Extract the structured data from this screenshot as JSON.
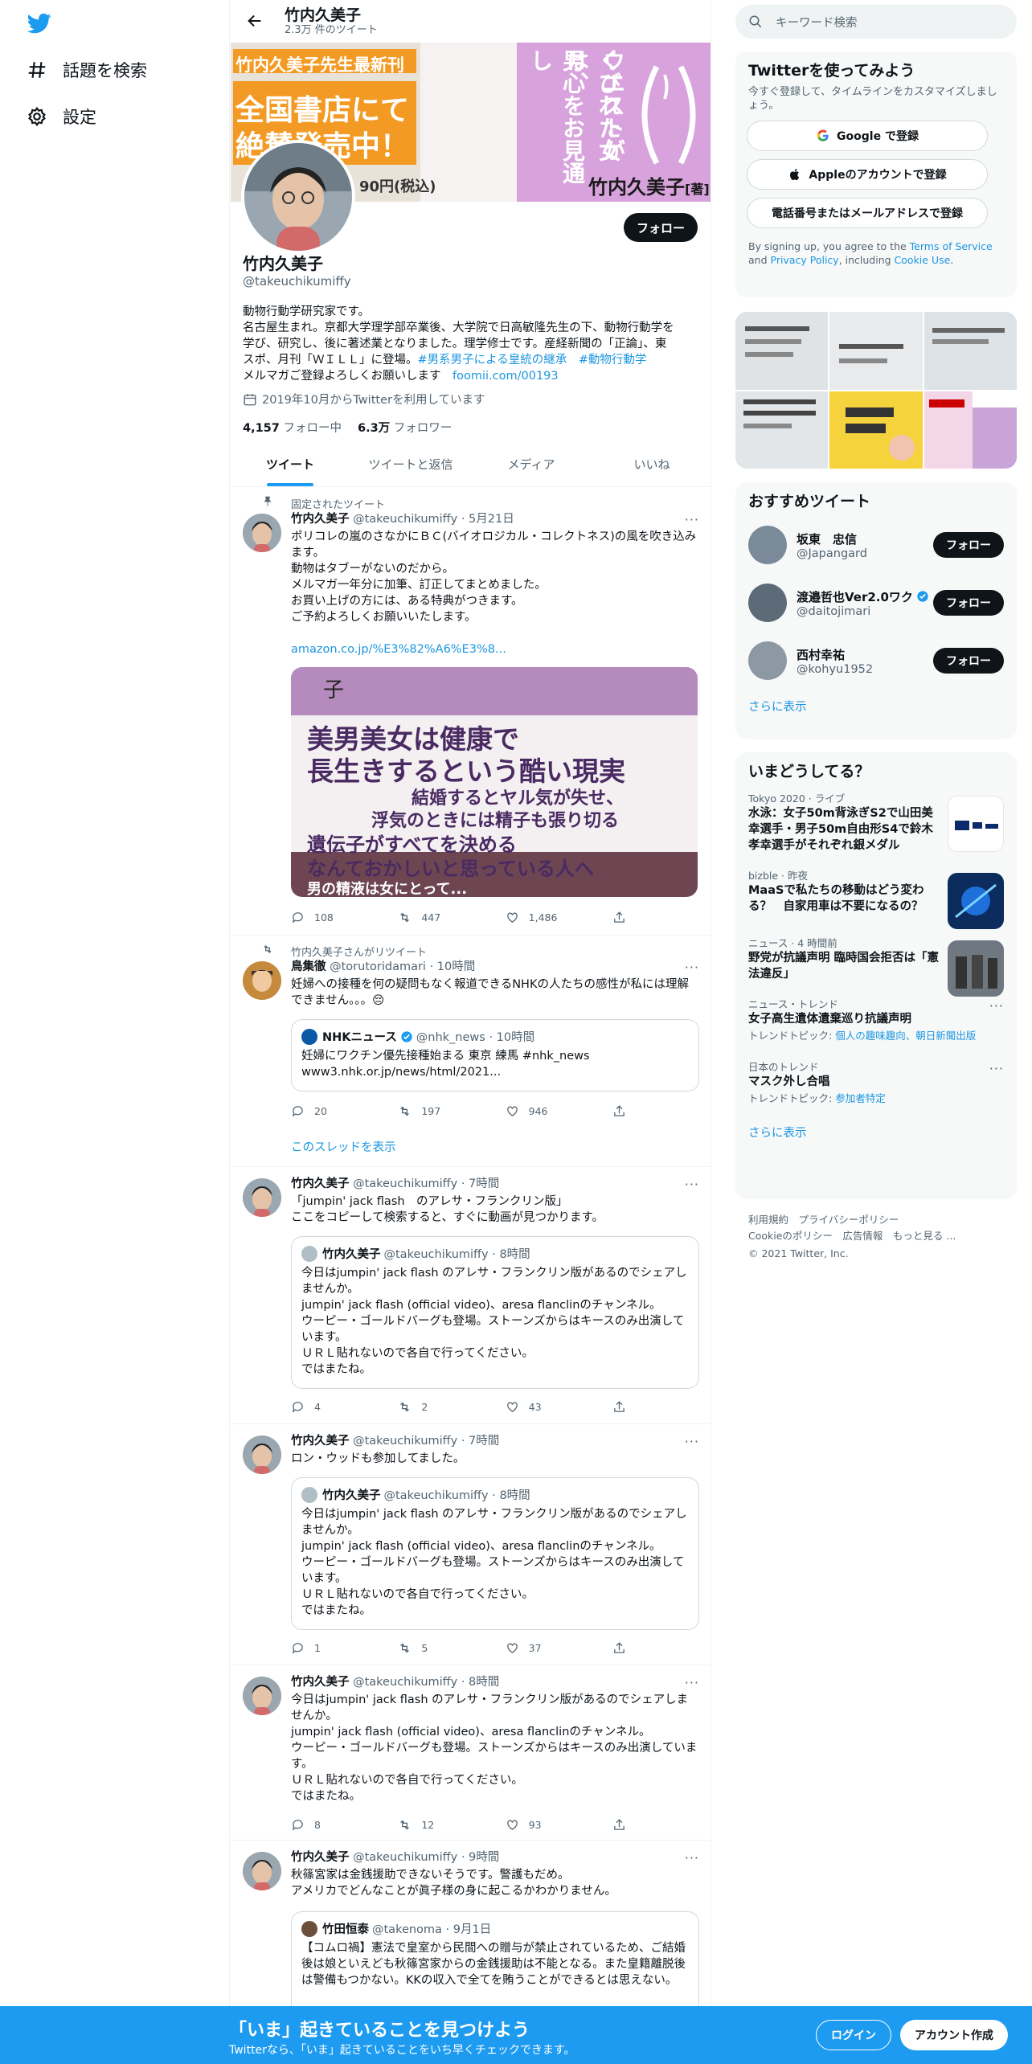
{
  "nav": {
    "explore": "話題を検索",
    "settings": "設定"
  },
  "profile": {
    "top_name": "竹内久美子",
    "tweet_count": "2.3万 件のツイート",
    "name": "竹内久美子",
    "handle": "@takeuchikumiffy",
    "follow": "フォロー",
    "bio_lines": [
      "動物行動学研究家です。",
      "名古屋生まれ。京都大学理学部卒業後、大学院で日高敏隆先生の下、動物行動学を",
      "学び、研究し、後に著述業となりました。理学修士です。産経新聞の「正論」、東"
    ],
    "bio_line4_text": "スポ、月刊「ＷＩＬＬ」に登場。",
    "bio_tag1": "#男系男子による皇統の継承",
    "bio_tag2": "#動物行動学",
    "bio_line5_text": "メルマガご登録よろしくお願いします",
    "bio_link": "foomii.com/00193",
    "joined": "2019年10月からTwitterを利用しています",
    "following_count": "4,157",
    "following_label": "フォロー中",
    "followers_count": "6.3万",
    "followers_label": "フォロワー"
  },
  "banner": {
    "left_top": "竹内久美子先生最新刊",
    "left_mid": "全国書店にて",
    "left_bot": "絶賛発売中！",
    "price": "90円(税込)",
    "book_title_a": "ウエストが",
    "book_title_b": "くびれた女は、",
    "book_title_c": "男心をお見通し",
    "author": "竹内久美子",
    "author_suffix": "[著]"
  },
  "tabs": [
    "ツイート",
    "ツイートと返信",
    "メディア",
    "いいね"
  ],
  "tweets": [
    {
      "context": "固定されたツイート",
      "name": "竹内久美子",
      "handle": "@takeuchikumiffy · 5月21日",
      "text": "ポリコレの嵐のさなかにＢＣ(バイオロジカル・コレクトネス)の風を吹き込みます。\n動物はタブーがないのだから。\nメルマガ一年分に加筆、訂正してまとめました。\nお買い上げの方には、ある特典がつきます。\nご予約よろしくお願いいたします。",
      "link": "amazon.co.jp/%E3%82%A6%E3%8...",
      "image_lines": [
        "美男美女は健康で",
        "長生きするという酷い現実",
        "結婚するとヤル気が失せ、",
        "浮気のときには精子も張り切る",
        "遺伝子がすべてを決める",
        "なんておかしいと思っている人へ",
        "男の精液は女にとって..."
      ],
      "image_top": "子",
      "replies": "108",
      "retweets": "447",
      "likes": "1,486"
    },
    {
      "context": "竹内久美子さんがリツイート",
      "name": "鳥集徹",
      "handle": "@torutoridamari · 10時間",
      "text": "妊婦への接種を何の疑問もなく報道できるNHKの人たちの感性が私には理解できません。。。😔",
      "quote_name": "NHKニュース",
      "quote_handle": "@nhk_news · 10時間",
      "quote_text": "妊婦にワクチン優先接種始まる 東京 練馬 #nhk_news\nwww3.nhk.or.jp/news/html/2021...",
      "replies": "20",
      "retweets": "197",
      "likes": "946",
      "show_thread": "このスレッドを表示"
    },
    {
      "name": "竹内久美子",
      "handle": "@takeuchikumiffy · 7時間",
      "text": "「jumpin' jack flash　のアレサ・フランクリン版」\nここをコピーして検索すると、すぐに動画が見つかります。",
      "quote_name": "竹内久美子",
      "quote_handle": "@takeuchikumiffy · 8時間",
      "quote_text": "今日はjumpin' jack flash のアレサ・フランクリン版があるのでシェアしませんか。\njumpin' jack flash (official video)、aresa flanclinのチャンネル。\nウーピー・ゴールドバーグも登場。ストーンズからはキースのみ出演しています。\nＵＲＬ貼れないので各自で行ってください。\nではまたね。",
      "replies": "4",
      "retweets": "2",
      "likes": "43"
    },
    {
      "name": "竹内久美子",
      "handle": "@takeuchikumiffy · 7時間",
      "text": "ロン・ウッドも参加してました。",
      "quote_name": "竹内久美子",
      "quote_handle": "@takeuchikumiffy · 8時間",
      "quote_text": "今日はjumpin' jack flash のアレサ・フランクリン版があるのでシェアしませんか。\njumpin' jack flash (official video)、aresa flanclinのチャンネル。\nウーピー・ゴールドバーグも登場。ストーンズからはキースのみ出演しています。\nＵＲＬ貼れないので各自で行ってください。\nではまたね。",
      "replies": "1",
      "retweets": "5",
      "likes": "37"
    },
    {
      "name": "竹内久美子",
      "handle": "@takeuchikumiffy · 8時間",
      "text": "今日はjumpin' jack flash のアレサ・フランクリン版があるのでシェアしませんか。\njumpin' jack flash (official video)、aresa flanclinのチャンネル。\nウーピー・ゴールドバーグも登場。ストーンズからはキースのみ出演しています。\nＵＲＬ貼れないので各自で行ってください。\nではまたね。",
      "replies": "8",
      "retweets": "12",
      "likes": "93"
    },
    {
      "name": "竹内久美子",
      "handle": "@takeuchikumiffy · 9時間",
      "text": "秋篠宮家は金銭援助できないそうです。警護もだめ。\nアメリカでどんなことが眞子様の身に起こるかわかりません。",
      "quote_name": "竹田恒泰",
      "quote_handle": "@takenoma · 9月1日",
      "quote_text": "【コムロ禍】憲法で皇室から民間への贈与が禁止されているため、ご結婚後は娘といえども秋篠宮家からの金銭援助は不能となる。また皇籍離脱後は警備もつかない。KKの収入で全てを賄うことができるとは思えない。"
    }
  ],
  "right": {
    "search_placeholder": "キーワード検索",
    "signup_title": "Twitterを使ってみよう",
    "signup_sub": "今すぐ登録して、タイムラインをカスタマイズしましょう。",
    "google": "Google で登録",
    "apple": "Appleのアカウントで登録",
    "phone": "電話番号またはメールアドレスで登録",
    "terms_pre": "By signing up, you agree to the ",
    "terms_tos": "Terms of Service",
    "terms_and": " and ",
    "terms_pp": "Privacy Policy",
    "terms_inc": ", including ",
    "terms_cookie": "Cookie Use",
    "terms_end": ".",
    "rec_title": "おすすめツイート",
    "recs": [
      {
        "name": "坂東　忠信",
        "handle": "@Japangard",
        "btn": "フォロー"
      },
      {
        "name": "渡邉哲也Ver2.0ワク",
        "handle": "@daitojimari",
        "btn": "フォロー"
      },
      {
        "name": "西村幸祐",
        "handle": "@kohyu1952",
        "btn": "フォロー"
      }
    ],
    "show_more": "さらに表示",
    "trend_title": "いまどうしてる？",
    "trends": [
      {
        "meta": "Tokyo 2020 · ライブ",
        "title": "水泳：女子50m背泳ぎS2で山田美幸選手・男子50m自由形S4で鈴木孝幸選手がそれぞれ銀メダル"
      },
      {
        "meta": "bizble · 昨夜",
        "title": "MaaSで私たちの移動はどう変わる？　自家用車は不要になるの？"
      },
      {
        "meta": "ニュース · 4 時間前",
        "title": "野党が抗議声明 臨時国会拒否は「憲法違反」"
      },
      {
        "meta": "ニュース・トレンド",
        "title": "女子高生遺体遺棄巡り抗議声明",
        "topic_label": "トレンドトピック: ",
        "topic": "個人の趣味趣向、朝日新聞出版"
      },
      {
        "meta": "日本のトレンド",
        "title": "マスク外し合唱",
        "topic_label": "トレンドトピック: ",
        "topic": "参加者特定"
      }
    ],
    "footer_1": "利用規約　プライバシーポリシー",
    "footer_2": "Cookieのポリシー　広告情報　もっと見る ...",
    "footer_3": "© 2021 Twitter, Inc."
  },
  "bottom": {
    "title": "「いま」起きていることを見つけよう",
    "sub": "Twitterなら、「いま」起きていることをいち早くチェックできます。",
    "login": "ログイン",
    "signup": "アカウント作成"
  },
  "colors": {
    "accent": "#1d9bf0",
    "link": "#1b95e0",
    "dark": "#0f1419"
  }
}
